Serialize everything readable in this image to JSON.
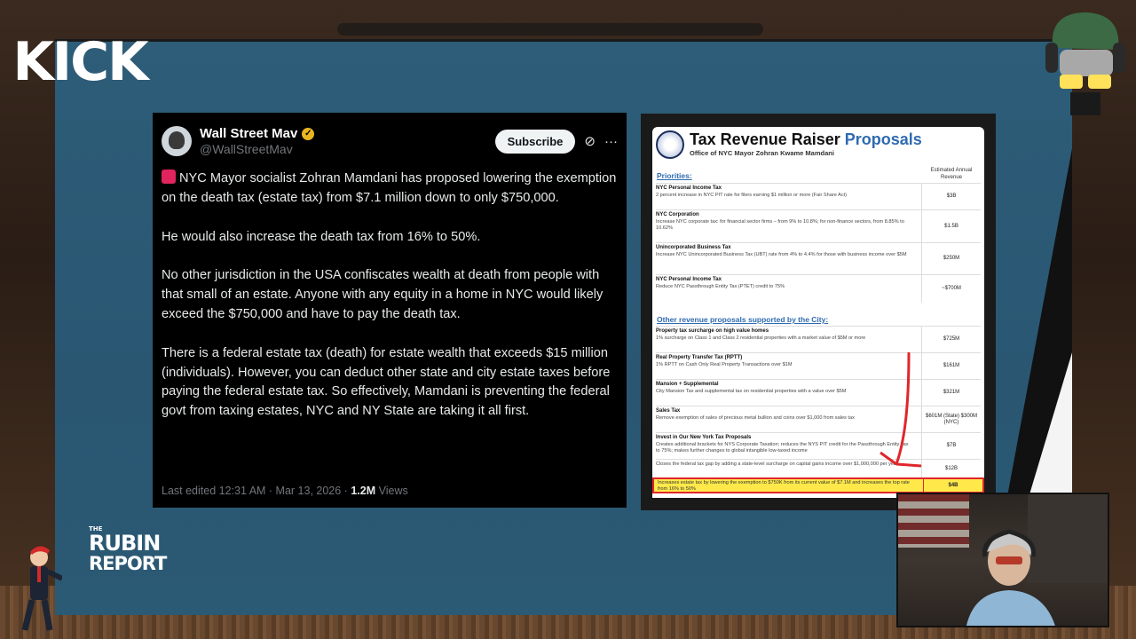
{
  "overlay": {
    "kick_logo": "KICK",
    "rubin_the": "THE",
    "rubin_line1": "RUBIN",
    "rubin_line2": "REPORT"
  },
  "tweet": {
    "author_name": "Wall Street Mav",
    "handle": "@WallStreetMav",
    "subscribe_label": "Subscribe",
    "paragraphs": [
      "NYC Mayor socialist Zohran Mamdani has proposed lowering the exemption on the death tax (estate tax) from $7.1 million down to only $750,000.",
      "He would also increase the death tax from 16% to 50%.",
      "No other jurisdiction in the USA confiscates wealth at death from people with that small of an estate. Anyone with any equity in a home in NYC would likely exceed the $750,000 and have to pay the death tax.",
      "There is a federal estate tax (death) for estate wealth that exceeds $15 million (individuals). However, you can deduct other state and city estate taxes before paying the federal estate tax. So effectively, Mamdani is preventing the federal govt from taxing estates, NYC and NY State are taking it all first."
    ],
    "meta_prefix": "Last edited 12:31 AM · Mar 13, 2026 · ",
    "views_count": "1.2M",
    "views_label": " Views"
  },
  "document": {
    "title_main": "Tax Revenue Raiser ",
    "title_accent": "Proposals",
    "subtitle": "Office of NYC Mayor Zohran Kwame Mamdani",
    "col_header": "Estimated Annual Revenue",
    "section1": "Priorities:",
    "section2": "Other revenue proposals supported by the City:",
    "priorities": [
      {
        "title": "NYC Personal Income Tax",
        "desc": "2 percent increase in NYC PIT rate for filers earning $1 million or more (Fair Share Act)",
        "value": "$3B"
      },
      {
        "title": "NYC Corporation",
        "desc": "Increase NYC corporate tax: for financial sector firms – from 9% to 10.8%; for non-finance sectors, from 8.85% to 10.62%",
        "value": "$1.5B"
      },
      {
        "title": "Unincorporated Business Tax",
        "desc": "Increase NYC Unincorporated Business Tax (UBT) rate from 4% to 4.4% for those with business income over $5M",
        "value": "$250M"
      },
      {
        "title": "NYC Personal Income Tax",
        "desc": "Reduce NYC Passthrough Entity Tax (PTET) credit to 75%",
        "value": "~$700M"
      }
    ],
    "others": [
      {
        "title": "Property tax surcharge on high value homes",
        "desc": "1% surcharge on Class 1 and Class 2 residential properties with a market value of $5M or more",
        "value": "$725M"
      },
      {
        "title": "Real Property Transfer Tax (RPTT)",
        "desc": "1% RPTT on Cash Only Real Property Transactions over $1M",
        "value": "$161M"
      },
      {
        "title": "Mansion + Supplemental",
        "desc": "City Mansion Tax and supplemental tax on residential properties with a value over $5M",
        "value": "$321M"
      },
      {
        "title": "Sales Tax",
        "desc": "Remove exemption of sales of precious metal bullion and coins over $1,000 from sales tax",
        "value": "$601M (State) $300M (NYC)"
      },
      {
        "title": "Invest in Our New York Tax Proposals",
        "desc": "Creates additional brackets for NYS Corporate Taxation; reduces the NYS PIT credit for the Passthrough Entity Tax to 75%; makes further changes to global intangible low-taxed income",
        "value": "$7B"
      },
      {
        "title": "",
        "desc": "Closes the federal tax gap by adding a state-level surcharge on capital gains income over $1,000,000 per year",
        "value": "$12B"
      }
    ],
    "highlight": {
      "desc": "Increases estate tax by lowering the exemption to $750K from its current value of $7.1M and increases the top rate from 16% to 50%",
      "value": "$4B"
    }
  }
}
